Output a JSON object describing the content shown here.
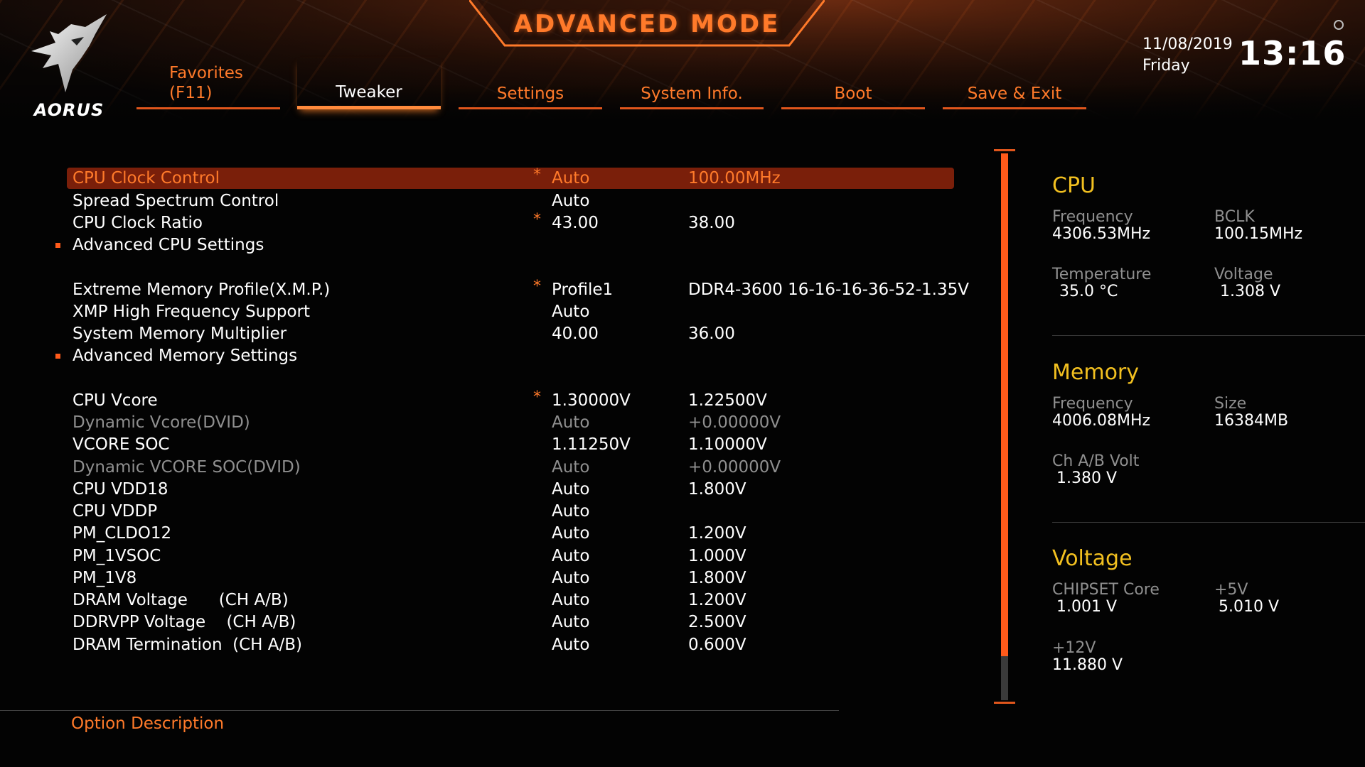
{
  "header": {
    "brand": "AORUS",
    "mode_title": "ADVANCED MODE",
    "date": "11/08/2019",
    "weekday": "Friday",
    "time": "13:16",
    "accent_color": "#ff7a2a"
  },
  "tabs": [
    {
      "line1": "Favorites",
      "line2": "(F11)"
    },
    {
      "label": "Tweaker",
      "active": true
    },
    {
      "label": "Settings"
    },
    {
      "label": "System Info."
    },
    {
      "label": "Boot"
    },
    {
      "label": "Save & Exit"
    }
  ],
  "settings": [
    {
      "name": "CPU Clock Control",
      "star": "*",
      "value": "Auto",
      "current": "100.00MHz",
      "selected": true
    },
    {
      "name": "Spread Spectrum Control",
      "value": "Auto"
    },
    {
      "name": "CPU Clock Ratio",
      "star": "*",
      "value": "43.00",
      "current": "38.00"
    },
    {
      "name": "Advanced CPU Settings",
      "submenu": true
    },
    {
      "name": "Extreme Memory Profile(X.M.P.)",
      "star": "*",
      "value": "Profile1",
      "current": "DDR4-3600 16-16-16-36-52-1.35V"
    },
    {
      "name": "XMP High Frequency Support",
      "value": "Auto"
    },
    {
      "name": "System Memory Multiplier",
      "value": "40.00",
      "current": "36.00"
    },
    {
      "name": "Advanced Memory Settings",
      "submenu": true
    },
    {
      "name": "CPU Vcore",
      "star": "*",
      "value": "1.30000V",
      "current": "1.22500V"
    },
    {
      "name": "Dynamic Vcore(DVID)",
      "value": "Auto",
      "current": "+0.00000V",
      "disabled": true
    },
    {
      "name": "VCORE SOC",
      "value": "1.11250V",
      "current": "1.10000V"
    },
    {
      "name": "Dynamic VCORE SOC(DVID)",
      "value": "Auto",
      "current": "+0.00000V",
      "disabled": true
    },
    {
      "name": "CPU VDD18",
      "value": "Auto",
      "current": "1.800V"
    },
    {
      "name": "CPU VDDP",
      "value": "Auto"
    },
    {
      "name": "PM_CLDO12",
      "value": "Auto",
      "current": "1.200V"
    },
    {
      "name": "PM_1VSOC",
      "value": "Auto",
      "current": "1.000V"
    },
    {
      "name": "PM_1V8",
      "value": "Auto",
      "current": "1.800V"
    },
    {
      "name": "DRAM Voltage      (CH A/B)",
      "value": "Auto",
      "current": "1.200V"
    },
    {
      "name": "DDRVPP Voltage    (CH A/B)",
      "value": "Auto",
      "current": "2.500V"
    },
    {
      "name": "DRAM Termination  (CH A/B)",
      "value": "Auto",
      "current": "0.600V"
    }
  ],
  "scroll": {
    "visible_fraction": 0.92
  },
  "info": {
    "cpu": {
      "title": "CPU",
      "frequency_label": "Frequency",
      "frequency": "4306.53MHz",
      "bclk_label": "BCLK",
      "bclk": "100.15MHz",
      "temperature_label": "Temperature",
      "temperature": "35.0 °C",
      "voltage_label": "Voltage",
      "voltage": "1.308 V"
    },
    "memory": {
      "title": "Memory",
      "frequency_label": "Frequency",
      "frequency": "4006.08MHz",
      "size_label": "Size",
      "size": "16384MB",
      "chab_label": "Ch A/B Volt",
      "chab": "1.380 V"
    },
    "voltage": {
      "title": "Voltage",
      "chipset_label": "CHIPSET Core",
      "chipset": "1.001 V",
      "p5v_label": "+5V",
      "p5v": "5.010 V",
      "p12v_label": "+12V",
      "p12v": "11.880 V"
    }
  },
  "footer": {
    "description_label": "Option Description"
  }
}
